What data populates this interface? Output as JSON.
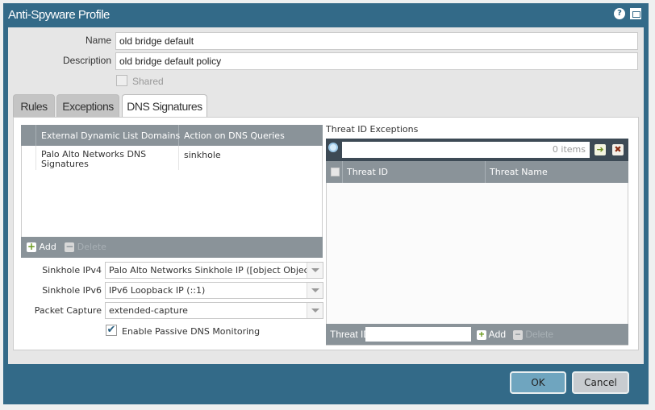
{
  "dialog": {
    "title": "Anti-Spyware Profile",
    "help_icon": "?"
  },
  "form": {
    "name_label": "Name",
    "name_value": "old bridge default",
    "description_label": "Description",
    "description_value": "old bridge default policy",
    "shared_label": "Shared",
    "shared_checked": false
  },
  "tabs": [
    {
      "label": "Rules"
    },
    {
      "label": "Exceptions"
    },
    {
      "label": "DNS Signatures",
      "active": true
    }
  ],
  "dns_grid": {
    "columns": [
      "External Dynamic List Domains",
      "Action on DNS Queries"
    ],
    "rows": [
      {
        "domain": "Palo Alto Networks DNS Signatures",
        "action": "sinkhole"
      }
    ],
    "add_label": "Add",
    "delete_label": "Delete"
  },
  "settings": {
    "sinkhole_ipv4_label": "Sinkhole IPv4",
    "sinkhole_ipv4_value": "Palo Alto Networks Sinkhole IP ([object Object])",
    "sinkhole_ipv6_label": "Sinkhole IPv6",
    "sinkhole_ipv6_value": "IPv6 Loopback IP (::1)",
    "packet_capture_label": "Packet Capture",
    "packet_capture_value": "extended-capture",
    "passive_dns_label": "Enable Passive DNS Monitoring",
    "passive_dns_checked": true
  },
  "threat_exceptions": {
    "title": "Threat ID Exceptions",
    "search_count": "0 items",
    "columns": [
      "Threat ID",
      "Threat Name"
    ],
    "threat_id_label": "Threat ID",
    "add_label": "Add",
    "delete_label": "Delete"
  },
  "footer": {
    "ok_label": "OK",
    "cancel_label": "Cancel"
  }
}
